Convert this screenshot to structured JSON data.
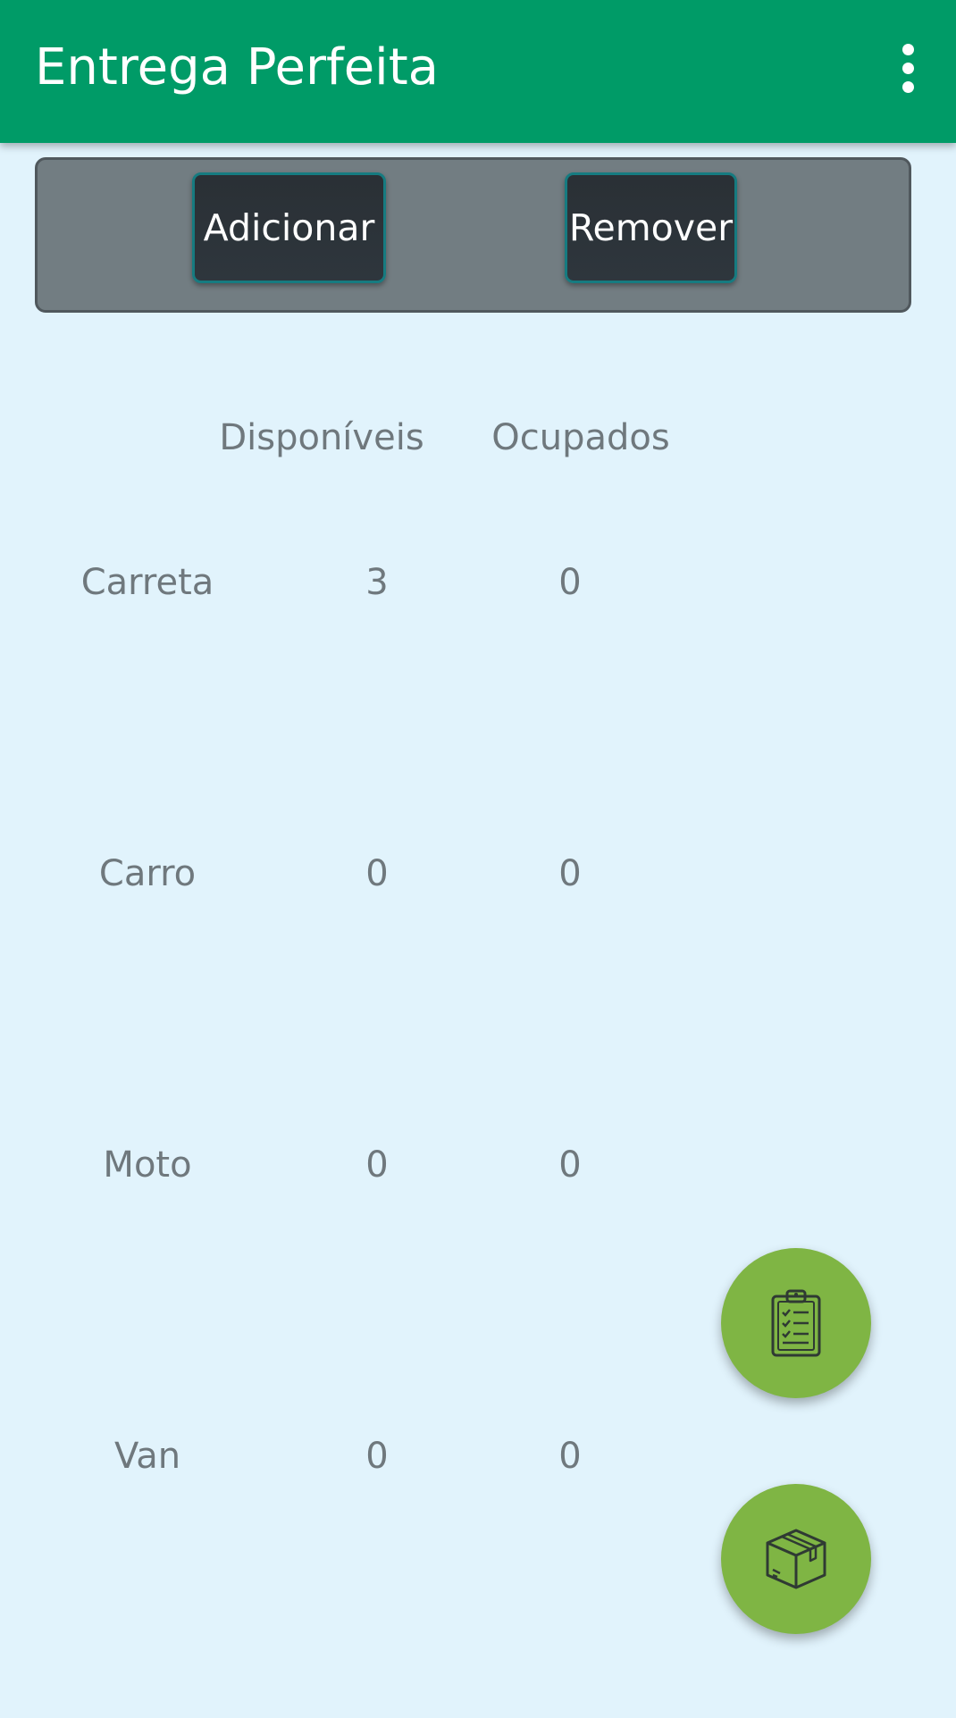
{
  "app_bar": {
    "title": "Entrega Perfeita",
    "menu_icon": "more-vert-icon"
  },
  "actions": {
    "add_label": "Adicionar",
    "remove_label": "Remover"
  },
  "table": {
    "headers": {
      "available": "Disponíveis",
      "occupied": "Ocupados"
    },
    "rows": [
      {
        "vehicle": "Carreta",
        "available": "3",
        "occupied": "0"
      },
      {
        "vehicle": "Carro",
        "available": "0",
        "occupied": "0"
      },
      {
        "vehicle": "Moto",
        "available": "0",
        "occupied": "0"
      },
      {
        "vehicle": "Van",
        "available": "0",
        "occupied": "0"
      }
    ]
  },
  "fabs": {
    "checklist_icon": "clipboard-checklist-icon",
    "package_icon": "package-box-icon"
  },
  "colors": {
    "app_bar": "#009B67",
    "background": "#E1F3FC",
    "panel": "#727D82",
    "button": "#2A3035",
    "button_border": "#167B80",
    "fab": "#7FB544",
    "text": "#6F787D"
  }
}
